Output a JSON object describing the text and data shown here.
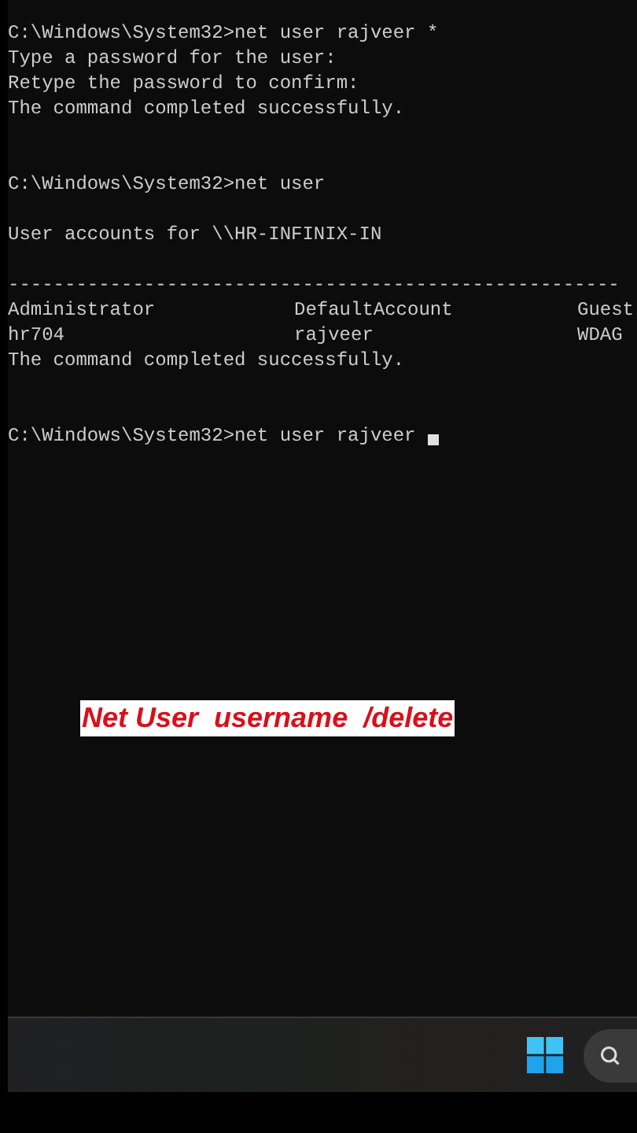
{
  "console": {
    "lines": [
      {
        "kind": "text",
        "text": "C:\\Windows\\System32>net user rajveer *"
      },
      {
        "kind": "text",
        "text": "Type a password for the user:"
      },
      {
        "kind": "text",
        "text": "Retype the password to confirm:"
      },
      {
        "kind": "text",
        "text": "The command completed successfully."
      },
      {
        "kind": "blank"
      },
      {
        "kind": "blank"
      },
      {
        "kind": "text",
        "text": "C:\\Windows\\System32>net user"
      },
      {
        "kind": "blank"
      },
      {
        "kind": "text",
        "text": "User accounts for \\\\HR-INFINIX-IN"
      },
      {
        "kind": "blank"
      },
      {
        "kind": "text",
        "text": "------------------------------------------------------"
      },
      {
        "kind": "columns",
        "cells": [
          "Administrator",
          "DefaultAccount",
          "Guest"
        ]
      },
      {
        "kind": "columns",
        "cells": [
          "hr704",
          "rajveer",
          "WDAG"
        ]
      },
      {
        "kind": "text",
        "text": "The command completed successfully."
      },
      {
        "kind": "blank"
      },
      {
        "kind": "blank"
      },
      {
        "kind": "text",
        "text": "C:\\Windows\\System32>net user rajveer ",
        "cursor": true
      }
    ]
  },
  "caption": "Net User  username  /delete"
}
